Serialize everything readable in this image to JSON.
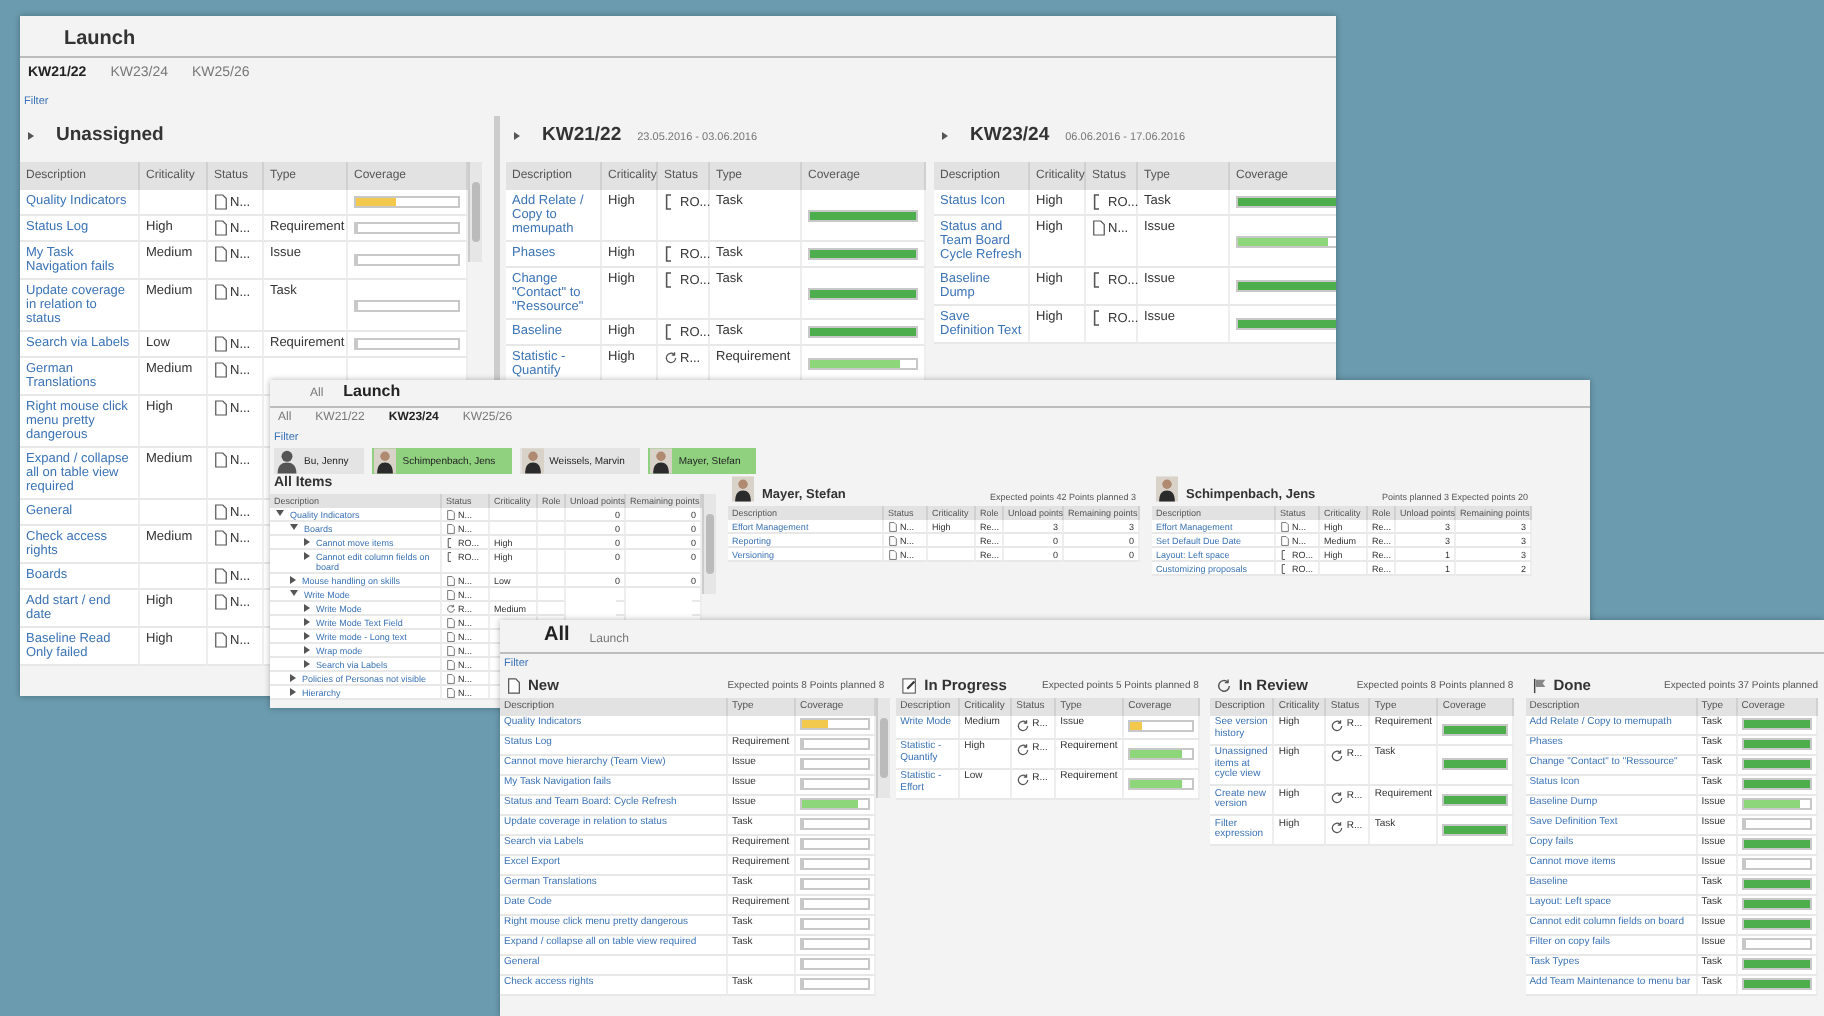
{
  "launch_window": {
    "title": "Launch",
    "tabs": [
      {
        "label": "KW21/22",
        "selected": true
      },
      {
        "label": "KW23/24",
        "selected": false
      },
      {
        "label": "KW25/26",
        "selected": false
      }
    ],
    "filter": "Filter",
    "unassigned": {
      "title": "Unassigned",
      "columns": [
        {
          "label": "Description",
          "kind": "link"
        },
        {
          "label": "Criticality",
          "kind": "text"
        },
        {
          "label": "Status",
          "kind": "status"
        },
        {
          "label": "Type",
          "kind": "text"
        },
        {
          "label": "Coverage",
          "kind": "coverage"
        }
      ],
      "rows": [
        {
          "cells": [
            "Quality Indicators",
            null,
            {
              "kind": "new",
              "text": "N..."
            },
            null,
            {
              "level": 0.4,
              "color": "#f2c94c"
            }
          ]
        },
        {
          "cells": [
            "Status Log",
            "High",
            {
              "kind": "new",
              "text": "N..."
            },
            "Requirement",
            {
              "level": 0
            }
          ]
        },
        {
          "cells": [
            "My Task Navigation fails",
            "Medium",
            {
              "kind": "new",
              "text": "N..."
            },
            "Issue",
            {
              "level": 0
            }
          ]
        },
        {
          "cells": [
            "Update coverage in relation to status",
            "Medium",
            {
              "kind": "new",
              "text": "N..."
            },
            "Task",
            {
              "level": 0
            }
          ]
        },
        {
          "cells": [
            "Search via Labels",
            "Low",
            {
              "kind": "new",
              "text": "N..."
            },
            "Requirement",
            {
              "level": 0
            }
          ]
        },
        {
          "cells": [
            "German Translations",
            "Medium",
            {
              "kind": "new",
              "text": "N..."
            }
          ]
        },
        {
          "cells": [
            "Right mouse click menu pretty dangerous",
            "High",
            {
              "kind": "new",
              "text": "N..."
            }
          ]
        },
        {
          "cells": [
            "Expand / collapse all on table view required",
            "Medium",
            {
              "kind": "new",
              "text": "N..."
            }
          ]
        },
        {
          "cells": [
            "General",
            null,
            {
              "kind": "new",
              "text": "N..."
            }
          ]
        },
        {
          "cells": [
            "Check access rights",
            "Medium",
            {
              "kind": "new",
              "text": "N..."
            }
          ]
        },
        {
          "cells": [
            "Boards",
            null,
            {
              "kind": "new",
              "text": "N..."
            }
          ]
        },
        {
          "cells": [
            "Add start / end date",
            "High",
            {
              "kind": "new",
              "text": "N..."
            }
          ]
        },
        {
          "cells": [
            "Baseline Read Only failed",
            "High",
            {
              "kind": "new",
              "text": "N..."
            }
          ]
        }
      ]
    },
    "sprints": [
      {
        "title": "KW21/22",
        "dates": "23.05.2016  - 03.06.2016",
        "columns": [
          {
            "label": "Description",
            "kind": "link"
          },
          {
            "label": "Criticality",
            "kind": "text"
          },
          {
            "label": "Status",
            "kind": "status"
          },
          {
            "label": "Type",
            "kind": "text"
          },
          {
            "label": "Coverage",
            "kind": "coverage"
          }
        ],
        "rows": [
          {
            "cells": [
              "Add Relate / Copy to memupath",
              "High",
              {
                "kind": "progress",
                "text": "RO..."
              },
              "Task",
              {
                "level": 1,
                "color": "#4cae4c"
              }
            ]
          },
          {
            "cells": [
              "Phases",
              "High",
              {
                "kind": "progress",
                "text": "RO..."
              },
              "Task",
              {
                "level": 1,
                "color": "#4cae4c"
              }
            ]
          },
          {
            "cells": [
              "Change \"Contact\" to \"Ressource\"",
              "High",
              {
                "kind": "progress",
                "text": "RO..."
              },
              "Task",
              {
                "level": 1,
                "color": "#4cae4c"
              }
            ]
          },
          {
            "cells": [
              "Baseline",
              "High",
              {
                "kind": "progress",
                "text": "RO..."
              },
              "Task",
              {
                "level": 1,
                "color": "#4cae4c"
              }
            ]
          },
          {
            "cells": [
              "Statistic - Quantify",
              "High",
              {
                "kind": "review",
                "text": "R..."
              },
              "Requirement",
              {
                "level": 0.85,
                "color": "#8ed67a"
              }
            ]
          }
        ]
      },
      {
        "title": "KW23/24",
        "dates": "06.06.2016  - 17.06.2016",
        "columns": [
          {
            "label": "Description",
            "kind": "link"
          },
          {
            "label": "Criticality",
            "kind": "text"
          },
          {
            "label": "Status",
            "kind": "status"
          },
          {
            "label": "Type",
            "kind": "text"
          },
          {
            "label": "Coverage",
            "kind": "coverage"
          }
        ],
        "rows": [
          {
            "cells": [
              "Status Icon",
              "High",
              {
                "kind": "progress",
                "text": "RO..."
              },
              "Task",
              {
                "level": 1,
                "color": "#4cae4c"
              }
            ]
          },
          {
            "cells": [
              "Status and Team Board Cycle Refresh",
              "High",
              {
                "kind": "new",
                "text": "N..."
              },
              "Issue",
              {
                "level": 0.85,
                "color": "#8ed67a"
              }
            ]
          },
          {
            "cells": [
              "Baseline Dump",
              "High",
              {
                "kind": "progress",
                "text": "RO..."
              },
              "Issue",
              {
                "level": 1,
                "color": "#4cae4c"
              }
            ]
          },
          {
            "cells": [
              "Save Definition Text",
              "High",
              {
                "kind": "progress",
                "text": "RO..."
              },
              "Issue",
              {
                "level": 1,
                "color": "#4cae4c"
              }
            ]
          }
        ]
      }
    ]
  },
  "sprint_window": {
    "apps": [
      {
        "label": "All",
        "selected": false
      },
      {
        "label": "Launch",
        "selected": true
      }
    ],
    "tabs": [
      {
        "label": "All",
        "selected": false
      },
      {
        "label": "KW21/22",
        "selected": false
      },
      {
        "label": "KW23/24",
        "selected": true
      },
      {
        "label": "KW25/26",
        "selected": false
      }
    ],
    "filter": "Filter",
    "people": [
      {
        "name": "Bu, Jenny",
        "selected": false,
        "kind": "placeholder"
      },
      {
        "name": "Schimpenbach, Jens",
        "selected": true,
        "kind": "photo"
      },
      {
        "name": "Weissels, Marvin",
        "selected": false,
        "kind": "photo"
      },
      {
        "name": "Mayer, Stefan",
        "selected": true,
        "kind": "photo"
      }
    ],
    "all_items": {
      "title": "All Items",
      "columns": [
        {
          "label": "Description",
          "kind": "tree"
        },
        {
          "label": "Status",
          "kind": "status"
        },
        {
          "label": "Criticality",
          "kind": "text"
        },
        {
          "label": "Role",
          "kind": "text"
        },
        {
          "label": "Unload points",
          "kind": "num"
        },
        {
          "label": "Remaining points",
          "kind": "num"
        }
      ],
      "tree": [
        {
          "label": "Quality Indicators",
          "expanded": true,
          "cells": [
            {
              "kind": "new",
              "text": "N..."
            },
            null,
            null,
            "0",
            "0"
          ],
          "children": [
            {
              "label": "Boards",
              "expanded": true,
              "cells": [
                {
                  "kind": "new",
                  "text": "N..."
                },
                null,
                null,
                "0",
                "0"
              ],
              "children": [
                {
                  "label": "Cannot move items",
                  "expanded": false,
                  "cells": [
                    {
                      "kind": "progress",
                      "text": "RO..."
                    },
                    "High",
                    null,
                    "0",
                    "0"
                  ]
                },
                {
                  "label": "Cannot edit column fields on board",
                  "expanded": false,
                  "cells": [
                    {
                      "kind": "progress",
                      "text": "RO..."
                    },
                    "High",
                    null,
                    "0",
                    "0"
                  ]
                }
              ]
            },
            {
              "label": "Mouse handling on skills",
              "expanded": false,
              "cells": [
                {
                  "kind": "new",
                  "text": "N..."
                },
                "Low",
                null,
                "0",
                "0"
              ]
            },
            {
              "label": "Write Mode",
              "expanded": true,
              "cells": [
                {
                  "kind": "new",
                  "text": "N..."
                },
                null,
                null,
                null,
                null
              ],
              "children": [
                {
                  "label": "Write Mode",
                  "expanded": false,
                  "cells": [
                    {
                      "kind": "review",
                      "text": "R..."
                    },
                    "Medium",
                    null,
                    null,
                    null
                  ]
                },
                {
                  "label": "Write Mode Text Field",
                  "expanded": false,
                  "cells": [
                    {
                      "kind": "new",
                      "text": "N..."
                    },
                    null,
                    null,
                    null,
                    null
                  ]
                },
                {
                  "label": "Write mode - Long text",
                  "expanded": false,
                  "cells": [
                    {
                      "kind": "new",
                      "text": "N..."
                    },
                    null,
                    null,
                    null,
                    null
                  ]
                },
                {
                  "label": "Wrap mode",
                  "expanded": false,
                  "cells": [
                    {
                      "kind": "new",
                      "text": "N..."
                    },
                    null,
                    null,
                    null,
                    null
                  ]
                },
                {
                  "label": "Search via Labels",
                  "expanded": false,
                  "cells": [
                    {
                      "kind": "new",
                      "text": "N..."
                    },
                    null,
                    null,
                    null,
                    null
                  ]
                }
              ]
            },
            {
              "label": "Policies of Personas not visible",
              "expanded": false,
              "cells": [
                {
                  "kind": "new",
                  "text": "N..."
                },
                null,
                null,
                null,
                null
              ]
            },
            {
              "label": "Hierarchy",
              "expanded": false,
              "cells": [
                {
                  "kind": "new",
                  "text": "N..."
                },
                null,
                null,
                null,
                null
              ]
            }
          ]
        }
      ]
    },
    "members": [
      {
        "name": "Mayer, Stefan",
        "stats": "Expected points 42 Points planned 3",
        "columns": [
          {
            "label": "Description",
            "kind": "link"
          },
          {
            "label": "Status",
            "kind": "status"
          },
          {
            "label": "Criticality",
            "kind": "text"
          },
          {
            "label": "Role",
            "kind": "text"
          },
          {
            "label": "Unload points",
            "kind": "num"
          },
          {
            "label": "Remaining points",
            "kind": "num"
          }
        ],
        "rows": [
          {
            "cells": [
              "Effort Management",
              {
                "kind": "new",
                "text": "N..."
              },
              "High",
              "Re...",
              "3",
              "3"
            ]
          },
          {
            "cells": [
              "Reporting",
              {
                "kind": "new",
                "text": "N..."
              },
              null,
              "Re...",
              "0",
              "0"
            ]
          },
          {
            "cells": [
              "Versioning",
              {
                "kind": "new",
                "text": "N..."
              },
              null,
              "Re...",
              "0",
              "0"
            ]
          }
        ]
      },
      {
        "name": "Schimpenbach, Jens",
        "stats": "Points planned 3 Expected points 20",
        "columns": [
          {
            "label": "Description",
            "kind": "link"
          },
          {
            "label": "Status",
            "kind": "status"
          },
          {
            "label": "Criticality",
            "kind": "text"
          },
          {
            "label": "Role",
            "kind": "text"
          },
          {
            "label": "Unload points",
            "kind": "num"
          },
          {
            "label": "Remaining points",
            "kind": "num"
          }
        ],
        "rows": [
          {
            "cells": [
              "Effort Management",
              {
                "kind": "new",
                "text": "N..."
              },
              "High",
              "Re...",
              "3",
              "3"
            ]
          },
          {
            "cells": [
              "Set Default Due Date",
              {
                "kind": "new",
                "text": "N..."
              },
              "Medium",
              "Re...",
              "3",
              "3"
            ]
          },
          {
            "cells": [
              "Layout: Left space",
              {
                "kind": "progress",
                "text": "RO..."
              },
              "High",
              "Re...",
              "1",
              "3"
            ]
          },
          {
            "cells": [
              "Customizing proposals",
              {
                "kind": "progress",
                "text": "RO..."
              },
              null,
              "Re...",
              "1",
              "2"
            ]
          }
        ]
      }
    ]
  },
  "board_window": {
    "apps": [
      {
        "label": "All",
        "selected": true
      },
      {
        "label": "Launch",
        "selected": false
      }
    ],
    "filter": "Filter",
    "lanes": [
      {
        "title": "New",
        "stats": "Expected points 8 Points planned 8",
        "columns": [
          {
            "label": "Description",
            "kind": "link"
          },
          {
            "label": "Type",
            "kind": "text"
          },
          {
            "label": "Coverage",
            "kind": "coverage"
          }
        ],
        "rows": [
          {
            "cells": [
              "Quality Indicators",
              null,
              {
                "level": 0.4,
                "color": "#f2c94c"
              }
            ]
          },
          {
            "cells": [
              "Status Log",
              "Requirement",
              {
                "level": 0
              }
            ]
          },
          {
            "cells": [
              "Cannot move hierarchy (Team View)",
              "Issue",
              {
                "level": 0
              }
            ]
          },
          {
            "cells": [
              "My Task Navigation fails",
              "Issue",
              {
                "level": 0
              }
            ]
          },
          {
            "cells": [
              "Status and Team Board: Cycle Refresh",
              "Issue",
              {
                "level": 0.85,
                "color": "#8ed67a"
              }
            ]
          },
          {
            "cells": [
              "Update coverage in relation to status",
              "Task",
              {
                "level": 0
              }
            ]
          },
          {
            "cells": [
              "Search via Labels",
              "Requirement",
              {
                "level": 0
              }
            ]
          },
          {
            "cells": [
              "Excel Export",
              "Requirement",
              {
                "level": 0
              }
            ]
          },
          {
            "cells": [
              "German Translations",
              "Task",
              {
                "level": 0
              }
            ]
          },
          {
            "cells": [
              "Date Code",
              "Requirement",
              {
                "level": 0
              }
            ]
          },
          {
            "cells": [
              "Right mouse click menu pretty dangerous",
              "Task",
              {
                "level": 0
              }
            ]
          },
          {
            "cells": [
              "Expand / collapse all on table view required",
              "Task",
              {
                "level": 0
              }
            ]
          },
          {
            "cells": [
              "General",
              null,
              {
                "level": 0
              }
            ]
          },
          {
            "cells": [
              "Check access rights",
              "Task",
              {
                "level": 0
              }
            ]
          }
        ]
      },
      {
        "title": "In Progress",
        "stats": "Expected points 5 Points planned 8",
        "columns": [
          {
            "label": "Description",
            "kind": "link"
          },
          {
            "label": "Criticality",
            "kind": "text"
          },
          {
            "label": "Status",
            "kind": "status"
          },
          {
            "label": "Type",
            "kind": "text"
          },
          {
            "label": "Coverage",
            "kind": "coverage"
          }
        ],
        "rows": [
          {
            "cells": [
              "Write Mode",
              "Medium",
              {
                "kind": "review",
                "text": "R..."
              },
              "Issue",
              {
                "level": 0.2,
                "color": "#f2c94c"
              }
            ]
          },
          {
            "cells": [
              "Statistic - Quantify",
              "High",
              {
                "kind": "review",
                "text": "R..."
              },
              "Requirement",
              {
                "level": 0.85,
                "color": "#8ed67a"
              }
            ]
          },
          {
            "cells": [
              "Statistic - Effort",
              "Low",
              {
                "kind": "review",
                "text": "R..."
              },
              "Requirement",
              {
                "level": 0.85,
                "color": "#8ed67a"
              }
            ]
          }
        ]
      },
      {
        "title": "In Review",
        "stats": "Expected points 8 Points planned 8",
        "columns": [
          {
            "label": "Description",
            "kind": "link"
          },
          {
            "label": "Criticality",
            "kind": "text"
          },
          {
            "label": "Status",
            "kind": "status"
          },
          {
            "label": "Type",
            "kind": "text"
          },
          {
            "label": "Coverage",
            "kind": "coverage"
          }
        ],
        "rows": [
          {
            "cells": [
              "See version history",
              "High",
              {
                "kind": "review",
                "text": "R..."
              },
              "Requirement",
              {
                "level": 1,
                "color": "#4cae4c"
              }
            ]
          },
          {
            "cells": [
              "Unassigned items at cycle view",
              "High",
              {
                "kind": "review",
                "text": "R..."
              },
              "Task",
              {
                "level": 1,
                "color": "#4cae4c"
              }
            ]
          },
          {
            "cells": [
              "Create new version",
              "High",
              {
                "kind": "review",
                "text": "R..."
              },
              "Requirement",
              {
                "level": 1,
                "color": "#4cae4c"
              }
            ]
          },
          {
            "cells": [
              "Filter expression",
              "High",
              {
                "kind": "review",
                "text": "R..."
              },
              "Task",
              {
                "level": 1,
                "color": "#4cae4c"
              }
            ]
          }
        ]
      },
      {
        "title": "Done",
        "stats": "Expected points 37 Points planned",
        "columns": [
          {
            "label": "Description",
            "kind": "link"
          },
          {
            "label": "Type",
            "kind": "text"
          },
          {
            "label": "Coverage",
            "kind": "coverage"
          }
        ],
        "rows": [
          {
            "cells": [
              "Add Relate / Copy to memupath",
              "Task",
              {
                "level": 1,
                "color": "#4cae4c"
              }
            ]
          },
          {
            "cells": [
              "Phases",
              "Task",
              {
                "level": 1,
                "color": "#4cae4c"
              }
            ]
          },
          {
            "cells": [
              "Change \"Contact\" to \"Ressource\"",
              "Task",
              {
                "level": 1,
                "color": "#4cae4c"
              }
            ]
          },
          {
            "cells": [
              "Status Icon",
              "Task",
              {
                "level": 1,
                "color": "#4cae4c"
              }
            ]
          },
          {
            "cells": [
              "Baseline Dump",
              "Issue",
              {
                "level": 0.85,
                "color": "#8ed67a"
              }
            ]
          },
          {
            "cells": [
              "Save Definition Text",
              "Issue",
              {
                "level": 0
              }
            ]
          },
          {
            "cells": [
              "Copy fails",
              "Issue",
              {
                "level": 1,
                "color": "#4cae4c"
              }
            ]
          },
          {
            "cells": [
              "Cannot move items",
              "Issue",
              {
                "level": 0
              }
            ]
          },
          {
            "cells": [
              "Baseline",
              "Task",
              {
                "level": 1,
                "color": "#4cae4c"
              }
            ]
          },
          {
            "cells": [
              "Layout: Left space",
              "Task",
              {
                "level": 1,
                "color": "#4cae4c"
              }
            ]
          },
          {
            "cells": [
              "Cannot edit column fields on board",
              "Issue",
              {
                "level": 1,
                "color": "#4cae4c"
              }
            ]
          },
          {
            "cells": [
              "Filter on copy fails",
              "Issue",
              {
                "level": 0
              }
            ]
          },
          {
            "cells": [
              "Task Types",
              "Task",
              {
                "level": 1,
                "color": "#4cae4c"
              }
            ]
          },
          {
            "cells": [
              "Add Team Maintenance to menu bar",
              "Task",
              {
                "level": 1,
                "color": "#4cae4c"
              }
            ]
          }
        ]
      }
    ]
  }
}
